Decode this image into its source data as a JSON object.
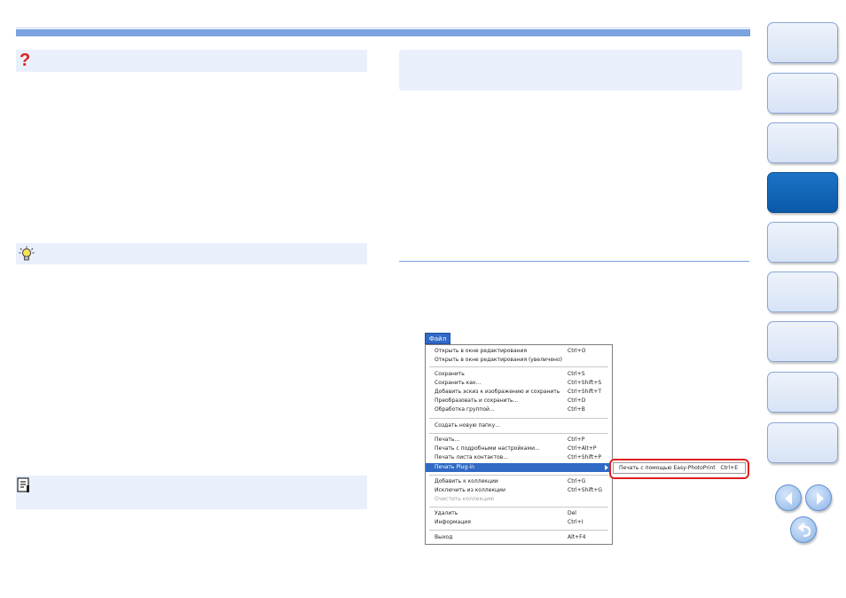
{
  "menu": {
    "title": "Файл",
    "items": [
      {
        "label": "Открыть в окне редактирования",
        "shortcut": "Ctrl+O"
      },
      {
        "label": "Открыть в окне редактирования (увеличено)",
        "shortcut": ""
      },
      {
        "label": "Сохранить",
        "shortcut": "Ctrl+S"
      },
      {
        "label": "Сохранить как...",
        "shortcut": "Ctrl+Shift+S"
      },
      {
        "label": "Добавить эскиз к изображению и сохранить",
        "shortcut": "Ctrl+Shift+T"
      },
      {
        "label": "Преобразовать и сохранить...",
        "shortcut": "Ctrl+D"
      },
      {
        "label": "Обработка группой...",
        "shortcut": "Ctrl+B"
      },
      {
        "label": "Создать новую папку...",
        "shortcut": ""
      },
      {
        "label": "Печать...",
        "shortcut": "Ctrl+P"
      },
      {
        "label": "Печать с подробными настройками...",
        "shortcut": "Ctrl+Alt+P"
      },
      {
        "label": "Печать листа контактов...",
        "shortcut": "Ctrl+Shift+P"
      },
      {
        "label": "Печать Plug-in",
        "shortcut": ""
      },
      {
        "label": "Добавить к коллекции",
        "shortcut": "Ctrl+G"
      },
      {
        "label": "Исключить из коллекции",
        "shortcut": "Ctrl+Shift+G"
      },
      {
        "label": "Очистить коллекцию",
        "shortcut": ""
      },
      {
        "label": "Удалить",
        "shortcut": "Del"
      },
      {
        "label": "Информация",
        "shortcut": "Ctrl+I"
      },
      {
        "label": "Выход",
        "shortcut": "Alt+F4"
      }
    ],
    "submenu": {
      "label": "Печать с помощью Easy-PhotoPrint",
      "shortcut": "Ctrl+E"
    }
  },
  "colors": {
    "accent": "#7aa3e0",
    "box_bg": "#e9f0fb",
    "active_tab": "#0a59a8",
    "highlight_red": "#e02020",
    "menu_selection": "#316ac5"
  },
  "icons": {
    "question": "question-icon",
    "hint": "lightbulb-icon",
    "note": "memo-icon",
    "prev": "arrow-left-icon",
    "next": "arrow-right-icon",
    "back": "return-arrow-icon"
  }
}
